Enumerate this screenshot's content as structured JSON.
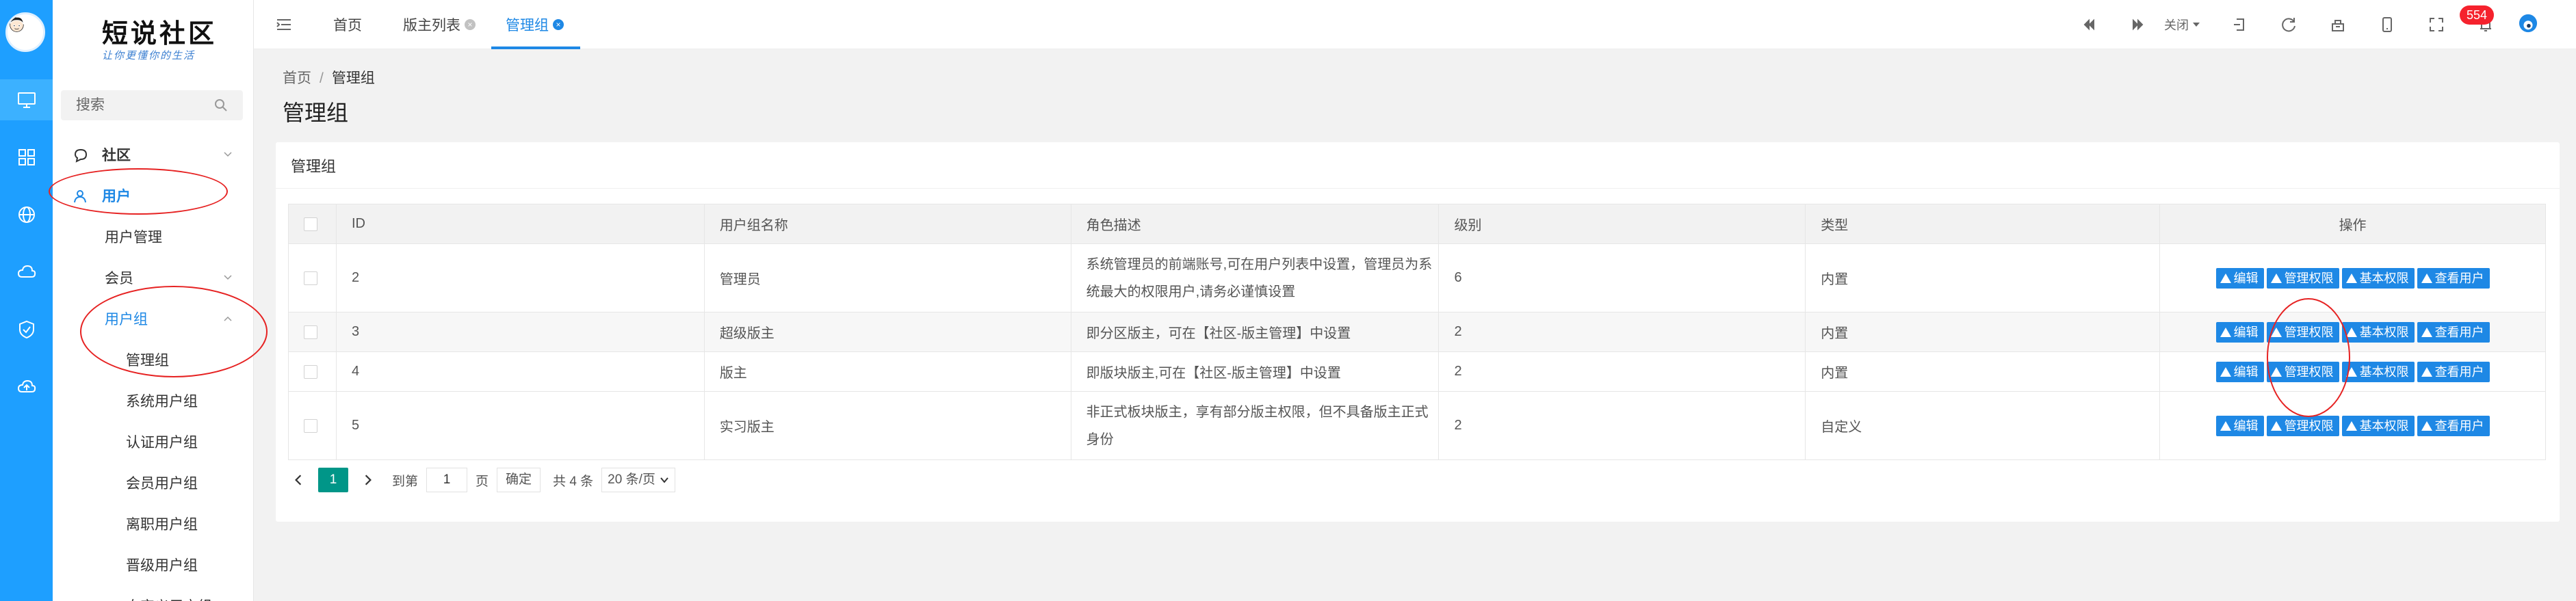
{
  "brand": {
    "title": "短说社区",
    "subtitle": "让你更懂你的生活"
  },
  "search": {
    "placeholder": "搜索"
  },
  "sidebar": {
    "items": [
      {
        "label": "社区"
      },
      {
        "label": "用户"
      },
      {
        "label": "用户管理"
      },
      {
        "label": "会员"
      },
      {
        "label": "用户组"
      },
      {
        "label": "管理组"
      },
      {
        "label": "系统用户组"
      },
      {
        "label": "认证用户组"
      },
      {
        "label": "会员用户组"
      },
      {
        "label": "离职用户组"
      },
      {
        "label": "晋级用户组"
      },
      {
        "label": "自定义用户组"
      }
    ]
  },
  "tabs": [
    {
      "label": "首页"
    },
    {
      "label": "版主列表"
    },
    {
      "label": "管理组"
    }
  ],
  "topbar": {
    "close_label": "关闭",
    "badge_count": "554"
  },
  "breadcrumb": {
    "home": "首页",
    "current": "管理组"
  },
  "page": {
    "title": "管理组",
    "card_title": "管理组"
  },
  "table": {
    "columns": [
      "ID",
      "用户组名称",
      "角色描述",
      "级别",
      "类型",
      "操作"
    ],
    "rows": [
      {
        "id": "2",
        "name": "管理员",
        "desc": "系统管理员的前端账号,可在用户列表中设置，管理员为系统最大的权限用户,请务必谨慎设置",
        "level": "6",
        "type": "内置"
      },
      {
        "id": "3",
        "name": "超级版主",
        "desc": "即分区版主，可在【社区-版主管理】中设置",
        "level": "2",
        "type": "内置"
      },
      {
        "id": "4",
        "name": "版主",
        "desc": "即版块版主,可在【社区-版主管理】中设置",
        "level": "2",
        "type": "内置"
      },
      {
        "id": "5",
        "name": "实习版主",
        "desc": "非正式板块版主，享有部分版主权限，但不具备版主正式身份",
        "level": "2",
        "type": "自定义"
      }
    ],
    "actions": [
      "编辑",
      "管理权限",
      "基本权限",
      "查看用户"
    ]
  },
  "pager": {
    "current": "1",
    "goto_label": "到第",
    "goto_value": "1",
    "page_label": "页",
    "confirm_label": "确定",
    "total_label": "共 4 条",
    "size_label": "20 条/页"
  }
}
